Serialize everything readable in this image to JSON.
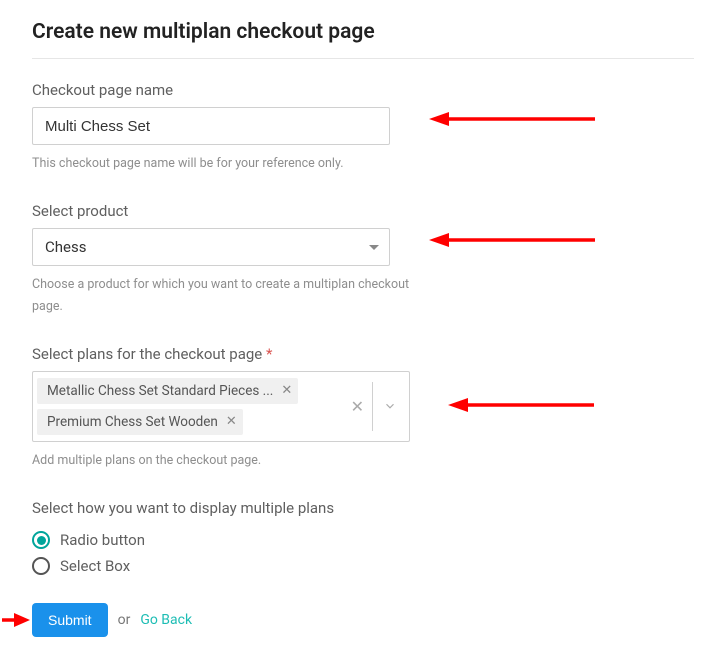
{
  "page_title": "Create new multiplan checkout page",
  "fields": {
    "name": {
      "label": "Checkout page name",
      "value": "Multi Chess Set",
      "help": "This checkout page name will be for your reference only."
    },
    "product": {
      "label": "Select product",
      "value": "Chess",
      "help": "Choose a product for which you want to create a multiplan checkout page."
    },
    "plans": {
      "label": "Select plans for the checkout page",
      "required_mark": "*",
      "tags": [
        "Metallic Chess Set Standard Pieces ...",
        "Premium Chess Set Wooden"
      ],
      "help": "Add multiple plans on the checkout page."
    },
    "display": {
      "label": "Select how you want to display multiple plans",
      "options": [
        {
          "label": "Radio button",
          "selected": true
        },
        {
          "label": "Select Box",
          "selected": false
        }
      ]
    }
  },
  "actions": {
    "submit": "Submit",
    "or": "or",
    "goback": "Go Back"
  }
}
